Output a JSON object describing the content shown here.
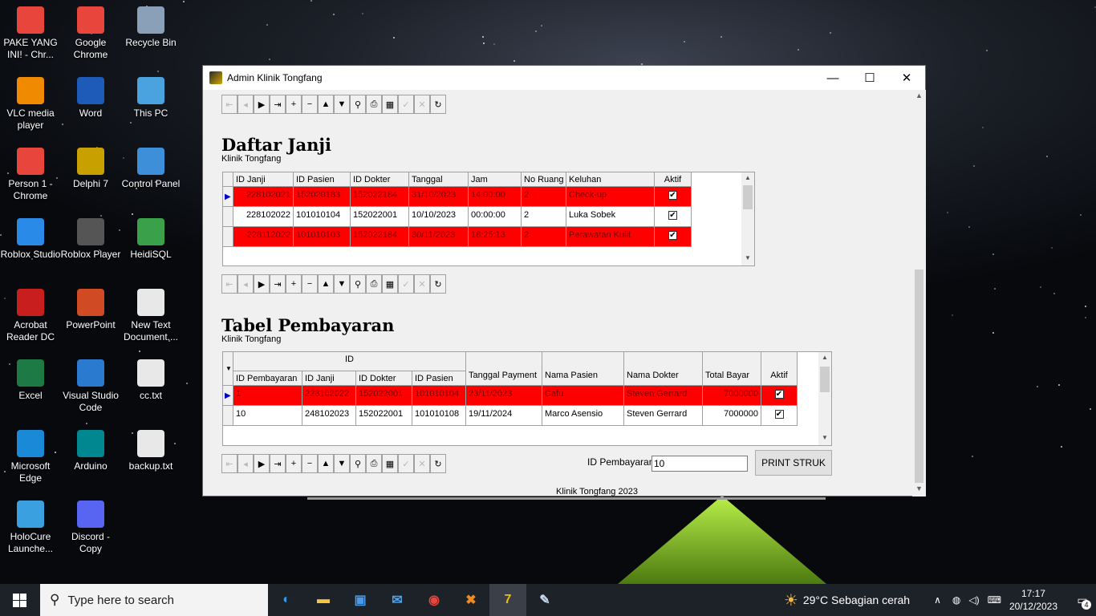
{
  "desktop": {
    "icons": [
      {
        "label": "PAKE YANG INI! - Chr...",
        "icon": "chrome-icon",
        "color": "#e8453c"
      },
      {
        "label": "Google Chrome",
        "icon": "chrome-icon",
        "color": "#e8453c"
      },
      {
        "label": "Recycle Bin",
        "icon": "recycle-bin-icon",
        "color": "#8aa0b8"
      },
      {
        "label": "VLC media player",
        "icon": "vlc-icon",
        "color": "#f08a00"
      },
      {
        "label": "Word",
        "icon": "word-icon",
        "color": "#1e5bb8"
      },
      {
        "label": "This PC",
        "icon": "pc-icon",
        "color": "#4aa3df"
      },
      {
        "label": "Person 1 - Chrome",
        "icon": "chrome-icon",
        "color": "#e8453c"
      },
      {
        "label": "Delphi 7",
        "icon": "delphi-icon",
        "color": "#c8a000"
      },
      {
        "label": "Control Panel",
        "icon": "control-panel-icon",
        "color": "#3c8fd8"
      },
      {
        "label": "Roblox Studio",
        "icon": "roblox-studio-icon",
        "color": "#2a8ae8"
      },
      {
        "label": "Roblox Player",
        "icon": "roblox-icon",
        "color": "#555555"
      },
      {
        "label": "HeidiSQL",
        "icon": "heidisql-icon",
        "color": "#3aa04a"
      },
      {
        "label": "Acrobat Reader DC",
        "icon": "acrobat-icon",
        "color": "#c81e1e"
      },
      {
        "label": "PowerPoint",
        "icon": "powerpoint-icon",
        "color": "#d04a24"
      },
      {
        "label": "New Text Document....",
        "icon": "text-file-icon",
        "color": "#e8e8e8"
      },
      {
        "label": "Excel",
        "icon": "excel-icon",
        "color": "#1d7a44"
      },
      {
        "label": "Visual Studio Code",
        "icon": "vscode-icon",
        "color": "#2a7ad0"
      },
      {
        "label": "cc.txt",
        "icon": "text-file-icon",
        "color": "#e8e8e8"
      },
      {
        "label": "Microsoft Edge",
        "icon": "edge-icon",
        "color": "#1a8ad8"
      },
      {
        "label": "Arduino",
        "icon": "arduino-icon",
        "color": "#00878f"
      },
      {
        "label": "backup.txt",
        "icon": "text-file-icon",
        "color": "#e8e8e8"
      },
      {
        "label": "HoloCure Launche...",
        "icon": "holocure-icon",
        "color": "#3aa0e0"
      },
      {
        "label": "Discord - Copy",
        "icon": "discord-icon",
        "color": "#5865f2"
      }
    ]
  },
  "window": {
    "title": "Admin Klinik Tongfang"
  },
  "janji": {
    "title": "Daftar Janji",
    "subtitle": "Klinik Tongfang",
    "columns": [
      "ID Janji",
      "ID Pasien",
      "ID Dokter",
      "Tanggal",
      "Jam",
      "No Ruang",
      "Keluhan",
      "Aktif"
    ],
    "rows": [
      {
        "id_janji": "228102021",
        "id_pasien": "152020183",
        "id_dokter": "152022184",
        "tanggal": "31/10/2023",
        "jam": "14:00:00",
        "ruang": "2",
        "keluhan": "Check-up",
        "aktif": "✔"
      },
      {
        "id_janji": "228102022",
        "id_pasien": "101010104",
        "id_dokter": "152022001",
        "tanggal": "10/10/2023",
        "jam": "00:00:00",
        "ruang": "2",
        "keluhan": "Luka Sobek",
        "aktif": "✔"
      },
      {
        "id_janji": "228112022",
        "id_pasien": "101010103",
        "id_dokter": "152022184",
        "tanggal": "30/11/2023",
        "jam": "18:25:13",
        "ruang": "2",
        "keluhan": "Perawatan Kulit",
        "aktif": "✔"
      }
    ]
  },
  "pembayaran": {
    "title": "Tabel Pembayaran",
    "subtitle": "Klinik Tongfang",
    "group_header": "ID",
    "columns": [
      "ID Pembayaran",
      "ID Janji",
      "ID Dokter",
      "ID Pasien",
      "Tanggal Payment",
      "Nama Pasien",
      "Nama Dokter",
      "Total Bayar",
      "Aktif"
    ],
    "rows": [
      {
        "id_pembayaran": "1",
        "id_janji": "228102022",
        "id_dokter": "152022001",
        "id_pasien": "101010104",
        "tanggal": "23/11/2023",
        "nama_pasien": "Cafu",
        "nama_dokter": "Steven Gerrard",
        "total": "7000000",
        "aktif": "✔"
      },
      {
        "id_pembayaran": "10",
        "id_janji": "248102023",
        "id_dokter": "152022001",
        "id_pasien": "101010108",
        "tanggal": "19/11/2024",
        "nama_pasien": "Marco Asensio",
        "nama_dokter": "Steven Gerrard",
        "total": "7000000",
        "aktif": "✔"
      }
    ]
  },
  "print": {
    "label": "ID Pembayaran",
    "value": "10",
    "button": "PRINT STRUK"
  },
  "footer": "Klinik Tongfang 2023",
  "navigator": [
    {
      "g": "⇤",
      "n": "first-icon",
      "d": true
    },
    {
      "g": "◂",
      "n": "prior-icon",
      "d": true
    },
    {
      "g": "▶",
      "n": "next-icon",
      "d": false
    },
    {
      "g": "⇥",
      "n": "last-icon",
      "d": false
    },
    {
      "g": "+",
      "n": "insert-icon",
      "d": false
    },
    {
      "g": "−",
      "n": "delete-icon",
      "d": false
    },
    {
      "g": "▲",
      "n": "edit-icon",
      "d": false
    },
    {
      "g": "▼",
      "n": "filter-icon",
      "d": false
    },
    {
      "g": "⚲",
      "n": "find-icon",
      "d": false
    },
    {
      "g": "⎙",
      "n": "print-icon",
      "d": false
    },
    {
      "g": "▦",
      "n": "grid-icon",
      "d": false
    },
    {
      "g": "✓",
      "n": "post-icon",
      "d": true
    },
    {
      "g": "✕",
      "n": "cancel-icon",
      "d": true
    },
    {
      "g": "↻",
      "n": "refresh-icon",
      "d": false
    }
  ],
  "taskbar": {
    "search_placeholder": "Type here to search",
    "weather": "29°C  Sebagian cerah",
    "time": "17:17",
    "date": "20/12/2023",
    "notifications": "4",
    "apps": [
      "edge-icon",
      "file-explorer-icon",
      "store-icon",
      "mail-icon",
      "chrome-icon",
      "xampp-icon",
      "delphi-icon",
      "paint-icon"
    ]
  }
}
